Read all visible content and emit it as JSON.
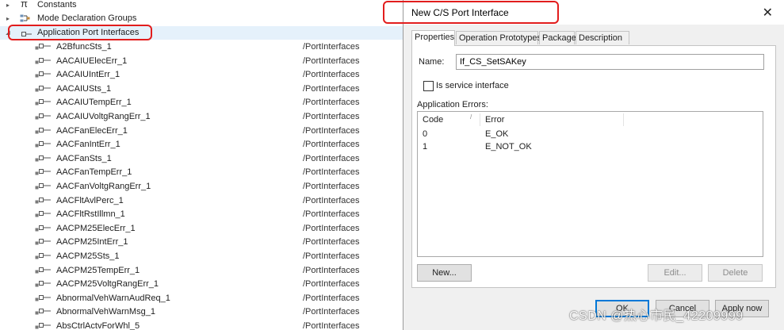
{
  "tree": {
    "top_items": [
      {
        "label": "Constants",
        "icon": "pi-icon"
      },
      {
        "label": "Mode Declaration Groups",
        "icon": "mode-group-icon"
      },
      {
        "label": "Application Port Interfaces",
        "icon": "port-interface-folder-icon"
      }
    ],
    "children": [
      {
        "name": "A2BfuncSts_1",
        "path": "/PortInterfaces"
      },
      {
        "name": "AACAIUElecErr_1",
        "path": "/PortInterfaces"
      },
      {
        "name": "AACAIUIntErr_1",
        "path": "/PortInterfaces"
      },
      {
        "name": "AACAIUSts_1",
        "path": "/PortInterfaces"
      },
      {
        "name": "AACAIUTempErr_1",
        "path": "/PortInterfaces"
      },
      {
        "name": "AACAIUVoltgRangErr_1",
        "path": "/PortInterfaces"
      },
      {
        "name": "AACFanElecErr_1",
        "path": "/PortInterfaces"
      },
      {
        "name": "AACFanIntErr_1",
        "path": "/PortInterfaces"
      },
      {
        "name": "AACFanSts_1",
        "path": "/PortInterfaces"
      },
      {
        "name": "AACFanTempErr_1",
        "path": "/PortInterfaces"
      },
      {
        "name": "AACFanVoltgRangErr_1",
        "path": "/PortInterfaces"
      },
      {
        "name": "AACFltAvlPerc_1",
        "path": "/PortInterfaces"
      },
      {
        "name": "AACFltRstIllmn_1",
        "path": "/PortInterfaces"
      },
      {
        "name": "AACPM25ElecErr_1",
        "path": "/PortInterfaces"
      },
      {
        "name": "AACPM25IntErr_1",
        "path": "/PortInterfaces"
      },
      {
        "name": "AACPM25Sts_1",
        "path": "/PortInterfaces"
      },
      {
        "name": "AACPM25TempErr_1",
        "path": "/PortInterfaces"
      },
      {
        "name": "AACPM25VoltgRangErr_1",
        "path": "/PortInterfaces"
      },
      {
        "name": "AbnormalVehWarnAudReq_1",
        "path": "/PortInterfaces"
      },
      {
        "name": "AbnormalVehWarnMsg_1",
        "path": "/PortInterfaces"
      },
      {
        "name": "AbsCtrlActvForWhl_5",
        "path": "/PortInterfaces"
      }
    ]
  },
  "dialog": {
    "title": "New C/S Port Interface",
    "tabs": [
      "Properties",
      "Operation Prototypes",
      "Package",
      "Description"
    ],
    "active_tab": "Properties",
    "name_label": "Name:",
    "name_value": "If_CS_SetSAKey",
    "service_checkbox_label": "Is service interface",
    "service_checked": false,
    "errors_label": "Application Errors:",
    "errors_columns": [
      "Code",
      "Error"
    ],
    "errors_rows": [
      {
        "code": "0",
        "error": "E_OK"
      },
      {
        "code": "1",
        "error": "E_NOT_OK"
      }
    ],
    "buttons": {
      "new": "New...",
      "edit": "Edit...",
      "delete": "Delete",
      "ok": "OK",
      "cancel": "Cancel",
      "apply": "Apply now"
    }
  },
  "watermark": "CSDN @热心市民_42209999",
  "colors": {
    "highlight_red": "#e21d1d",
    "selection_bg": "#e5f1fb",
    "dialog_bg": "#f0f0f0"
  }
}
